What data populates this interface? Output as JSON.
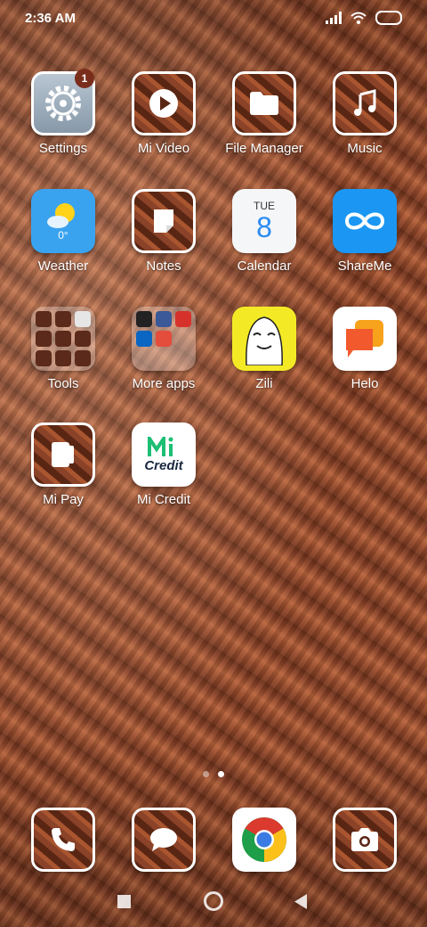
{
  "status": {
    "time": "2:36 AM"
  },
  "apps": {
    "settings": {
      "label": "Settings",
      "badge": "1"
    },
    "mi_video": {
      "label": "Mi Video"
    },
    "file_manager": {
      "label": "File Manager"
    },
    "music": {
      "label": "Music"
    },
    "weather": {
      "label": "Weather",
      "temp": "0°"
    },
    "notes": {
      "label": "Notes"
    },
    "calendar": {
      "label": "Calendar",
      "day": "TUE",
      "date": "8"
    },
    "shareme": {
      "label": "ShareMe"
    },
    "tools": {
      "label": "Tools"
    },
    "more_apps": {
      "label": "More apps"
    },
    "zili": {
      "label": "Zili"
    },
    "helo": {
      "label": "Helo"
    },
    "mi_pay": {
      "label": "Mi Pay"
    },
    "mi_credit": {
      "label": "Mi Credit",
      "logo_text": "Credit"
    }
  },
  "page_indicator": {
    "count": 2,
    "active": 2
  },
  "colors": {
    "weather": "#3aa3f0",
    "shareme": "#1b97f3",
    "zili": "#f3ea25",
    "helo": "#f25a2e",
    "mi_credit": "#1dbf73"
  }
}
